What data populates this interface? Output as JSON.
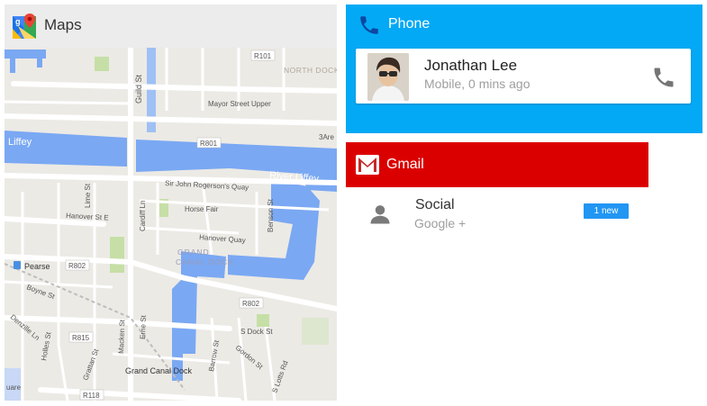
{
  "maps": {
    "title": "Maps",
    "labels": {
      "north_dock": "NORTH DOCK",
      "mayor_street_upper": "Mayor Street Upper",
      "guild_st": "Guild St",
      "r101": "R101",
      "r801": "R801",
      "three_are": "3Are",
      "liffey_left": "Liffey",
      "river_liffey": "River Liffey",
      "sir_john_rogersons_quay": "Sir John Rogerson's Quay",
      "hanover_st_e": "Hanover St E",
      "lime_st": "Lime St",
      "cardiff_ln": "Cardiff Ln",
      "horse_fair": "Horse Fair",
      "benson_st": "Benson St",
      "hanover_quay": "Hanover Quay",
      "grand": "GRAND",
      "canal_dock": "CANAL DOCK",
      "pearse": "Pearse",
      "r802_left": "R802",
      "r802_right": "R802",
      "boyne_st": "Boyne St",
      "denzille_ln": "Denzille Ln",
      "r815": "R815",
      "holles_st": "Holles St",
      "grattan_st": "Grattan St",
      "macken_st": "Macken St",
      "erne_st": "Erne St",
      "s_dock_st": "S Dock St",
      "barrow_st": "Barrow St",
      "gordon_st": "Gordon St",
      "s_lotts_rd": "S Lotts Rd",
      "grand_canal_dock": "Grand Canal Dock",
      "r118": "R118",
      "quare": "uare"
    }
  },
  "phone": {
    "title": "Phone",
    "contact": {
      "name": "Jonathan Lee",
      "subtitle": "Mobile, 0 mins ago"
    }
  },
  "gmail": {
    "title": "Gmail",
    "item": {
      "title": "Social",
      "subtitle": "Google +",
      "badge": "1 new"
    }
  },
  "colors": {
    "maps_header": "#ececec",
    "phone_accent": "#03a9f4",
    "gmail_accent": "#db0000",
    "badge": "#2196f3",
    "water": "#7aa8f3",
    "land": "#eceae5"
  },
  "icons": {
    "maps": "google-maps-logo-icon",
    "phone": "phone-handset-icon",
    "call": "call-icon",
    "gmail": "gmail-envelope-icon",
    "person": "person-icon"
  }
}
